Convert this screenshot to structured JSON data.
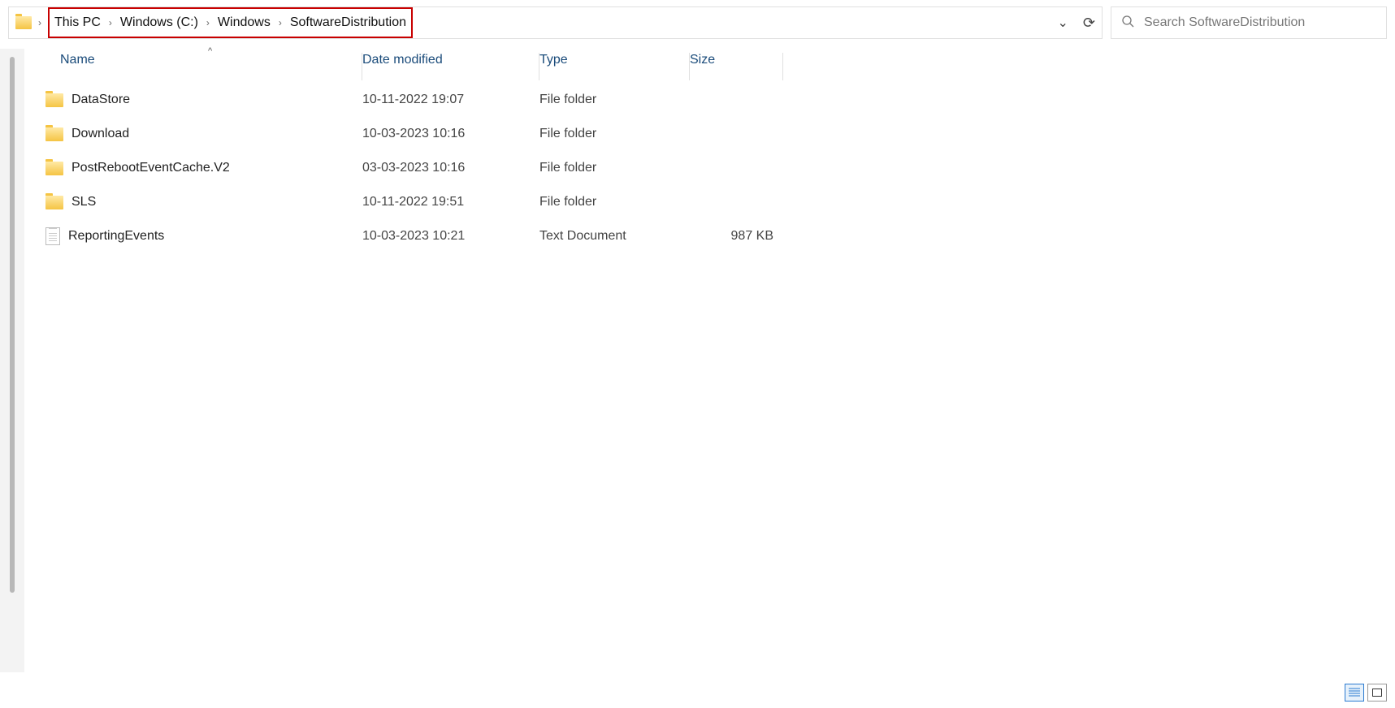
{
  "breadcrumb": {
    "items": [
      "This PC",
      "Windows (C:)",
      "Windows",
      "SoftwareDistribution"
    ]
  },
  "search": {
    "placeholder": "Search SoftwareDistribution"
  },
  "columns": {
    "name": "Name",
    "date": "Date modified",
    "type": "Type",
    "size": "Size"
  },
  "rows": [
    {
      "icon": "folder",
      "name": "DataStore",
      "date": "10-11-2022 19:07",
      "type": "File folder",
      "size": ""
    },
    {
      "icon": "folder",
      "name": "Download",
      "date": "10-03-2023 10:16",
      "type": "File folder",
      "size": ""
    },
    {
      "icon": "folder",
      "name": "PostRebootEventCache.V2",
      "date": "03-03-2023 10:16",
      "type": "File folder",
      "size": ""
    },
    {
      "icon": "folder",
      "name": "SLS",
      "date": "10-11-2022 19:51",
      "type": "File folder",
      "size": ""
    },
    {
      "icon": "file",
      "name": "ReportingEvents",
      "date": "10-03-2023 10:21",
      "type": "Text Document",
      "size": "987 KB"
    }
  ]
}
